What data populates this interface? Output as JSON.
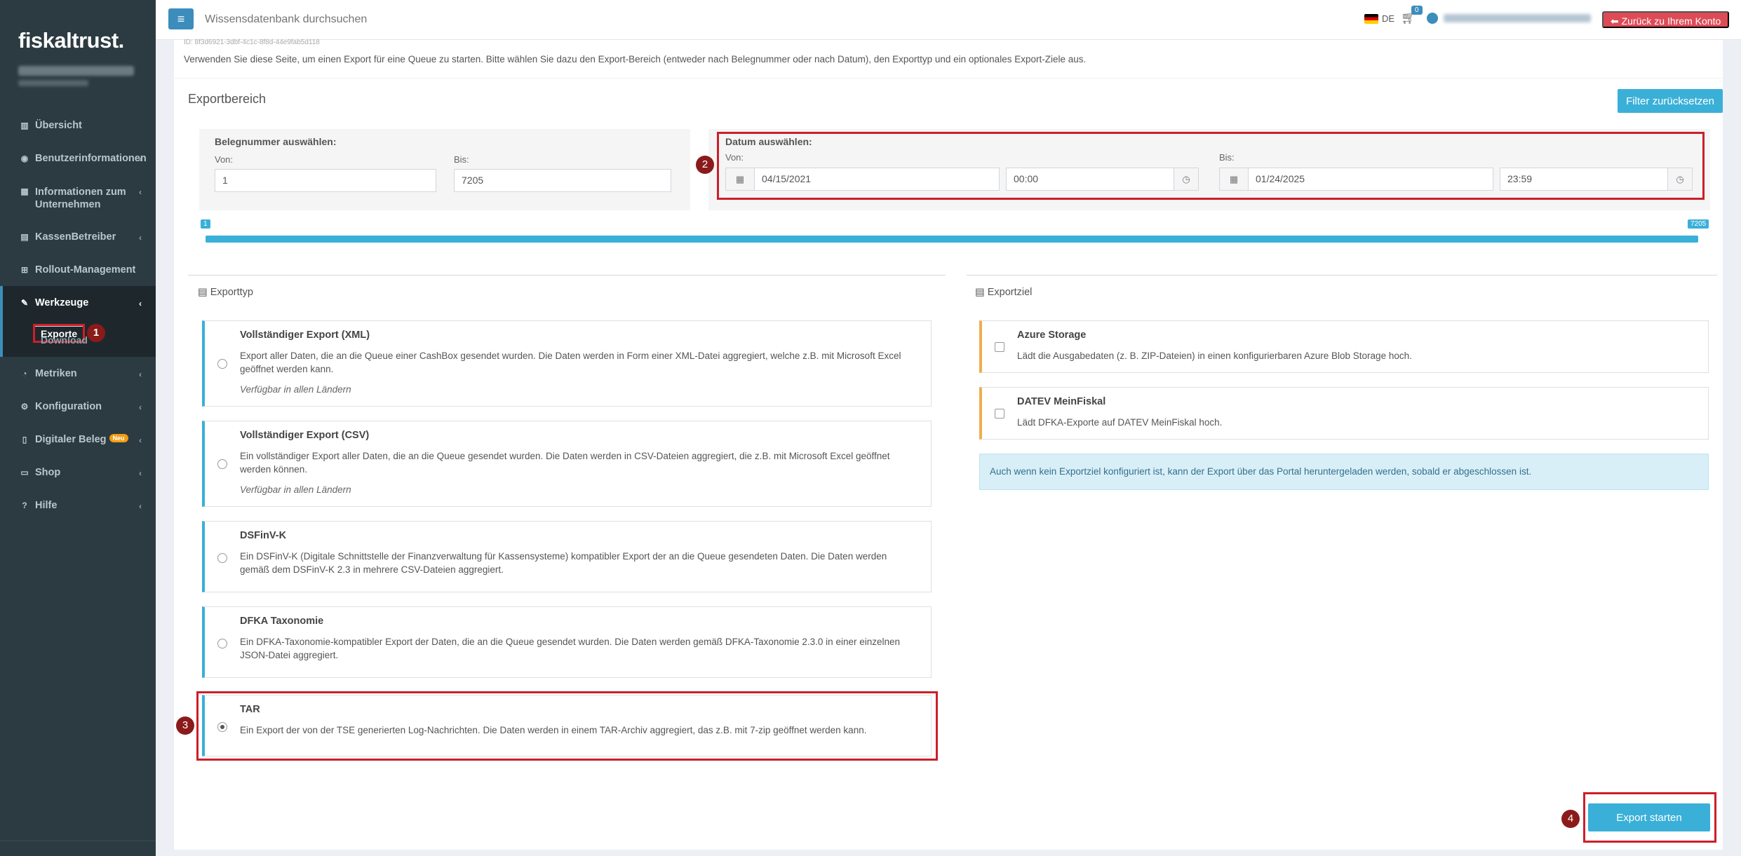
{
  "sidebar": {
    "logo": "fiskaltrust.",
    "items": [
      {
        "label": "Übersicht",
        "icon": "bar-chart-icon"
      },
      {
        "label": "Benutzerinformationen",
        "icon": "user-circle-icon"
      },
      {
        "label": "Informationen zum Unternehmen",
        "icon": "building-icon"
      },
      {
        "label": "KassenBetreiber",
        "icon": "book-icon"
      },
      {
        "label": "Rollout-Management",
        "icon": "plus-square-icon"
      },
      {
        "label": "Werkzeuge",
        "icon": "wrench-icon"
      },
      {
        "label": "Metriken",
        "icon": "tachometer-icon"
      },
      {
        "label": "Konfiguration",
        "icon": "cogs-icon"
      },
      {
        "label": "Digitaler Beleg",
        "icon": "file-icon",
        "badge": "Neu"
      },
      {
        "label": "Shop",
        "icon": "credit-card-icon"
      },
      {
        "label": "Hilfe",
        "icon": "question-icon"
      }
    ],
    "submenu": [
      "Exporte",
      "Download"
    ]
  },
  "markers": [
    "1",
    "2",
    "3",
    "4"
  ],
  "header": {
    "search_placeholder": "Wissensdatenbank durchsuchen",
    "language": "DE",
    "cart_count": "0",
    "back_button": "Zurück zu Ihrem Konto"
  },
  "main": {
    "queue_id": "ID: 8f3d6921-3dbf-4c1c-8f8d-44e9fab5d118",
    "intro": "Verwenden Sie diese Seite, um einen Export für eine Queue zu starten. Bitte wählen Sie dazu den Export-Bereich (entweder nach Belegnummer oder nach Datum), den Exporttyp und ein optionales Export-Ziele aus.",
    "range_title": "Exportbereich",
    "reset_button": "Filter zurücksetzen",
    "beleg": {
      "title": "Belegnummer auswählen:",
      "from_label": "Von:",
      "to_label": "Bis:",
      "from": "1",
      "to": "7205"
    },
    "datum": {
      "title": "Datum auswählen:",
      "from_label": "Von:",
      "to_label": "Bis:",
      "from_date": "04/15/2021",
      "from_time": "00:00",
      "to_date": "01/24/2025",
      "to_time": "23:59"
    },
    "slider": {
      "min_label": "1",
      "max_label": "7205",
      "min": 1,
      "max": 7205
    },
    "exporttyp": {
      "title": "Exporttyp",
      "options": [
        {
          "title": "Vollständiger Export (XML)",
          "desc": "Export aller Daten, die an die Queue einer CashBox gesendet wurden. Die Daten werden in Form einer XML-Datei aggregiert, welche z.B. mit Microsoft Excel geöffnet werden kann.",
          "note": "Verfügbar in allen Ländern"
        },
        {
          "title": "Vollständiger Export (CSV)",
          "desc": "Ein vollständiger Export aller Daten, die an die Queue gesendet wurden. Die Daten werden in CSV-Dateien aggregiert, die z.B. mit Microsoft Excel geöffnet werden können.",
          "note": "Verfügbar in allen Ländern"
        },
        {
          "title": "DSFinV-K",
          "desc": "Ein DSFinV-K (Digitale Schnittstelle der Finanzverwaltung für Kassensysteme) kompatibler Export der an die Queue gesendeten Daten. Die Daten werden gemäß dem DSFinV-K 2.3 in mehrere CSV-Dateien aggregiert."
        },
        {
          "title": "DFKA Taxonomie",
          "desc": "Ein DFKA-Taxonomie-kompatibler Export der Daten, die an die Queue gesendet wurden. Die Daten werden gemäß DFKA-Taxonomie 2.3.0 in einer einzelnen JSON-Datei aggregiert."
        },
        {
          "title": "TAR",
          "desc": "Ein Export der von der TSE generierten Log-Nachrichten. Die Daten werden in einem TAR-Archiv aggregiert, das z.B. mit 7-zip geöffnet werden kann."
        }
      ]
    },
    "exportziel": {
      "title": "Exportziel",
      "options": [
        {
          "title": "Azure Storage",
          "desc": "Lädt die Ausgabedaten (z. B. ZIP-Dateien) in einen konfigurierbaren Azure Blob Storage hoch."
        },
        {
          "title": "DATEV MeinFiskal",
          "desc": "Lädt DFKA-Exporte auf DATEV MeinFiskal hoch."
        }
      ],
      "info": "Auch wenn kein Exportziel konfiguriert ist, kann der Export über das Portal heruntergeladen werden, sobald er abgeschlossen ist."
    },
    "export_button": "Export starten"
  },
  "colors": {
    "accent": "#3ab0d8",
    "highlight": "#cc1f29",
    "sidebar": "#2c3b41",
    "warn": "#dd4b57"
  }
}
